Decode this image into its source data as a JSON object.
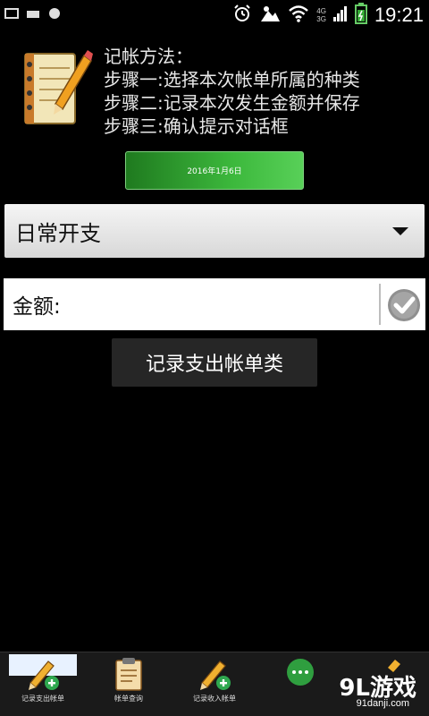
{
  "status_bar": {
    "time": "19:21",
    "network_top": "4G",
    "network_bottom": "3G"
  },
  "header": {
    "steps": [
      "记帐方法：",
      "步骤一:选择本次帐单所属的种类",
      "步骤二:记录本次发生金额并保存",
      "步骤三:确认提示对话框"
    ]
  },
  "date_button": {
    "label": "2016年1月6日"
  },
  "category_spinner": {
    "selected": "日常开支"
  },
  "amount": {
    "label": "金额:",
    "value": ""
  },
  "record_button": {
    "label": "记录支出帐单类"
  },
  "tabs": [
    {
      "label": "记录支出帐单",
      "icon": "pencil-add-icon",
      "selected": true
    },
    {
      "label": "帐单查询",
      "icon": "clipboard-icon",
      "selected": false
    },
    {
      "label": "记录收入帐单",
      "icon": "pencil-add-icon",
      "selected": false
    },
    {
      "label": "",
      "icon": "chat-bubble-icon",
      "selected": false
    },
    {
      "label": "",
      "icon": "pencil-icon",
      "selected": false
    }
  ],
  "watermark": {
    "brand": "9L游戏",
    "url": "91danji.com"
  },
  "colors": {
    "date_button": "#3cb83c",
    "background": "#000000"
  }
}
